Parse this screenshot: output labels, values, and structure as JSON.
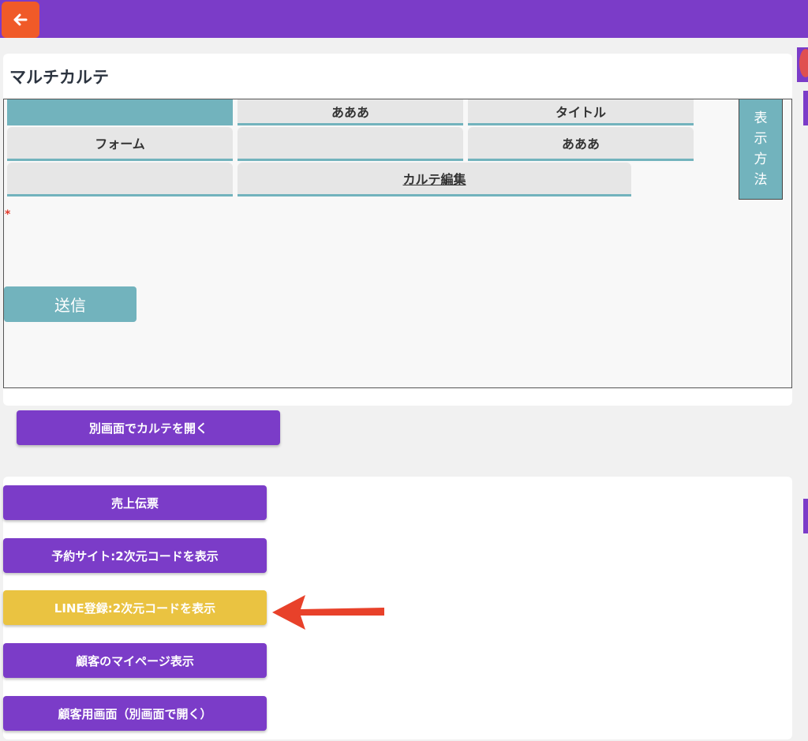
{
  "topbar": {
    "back_icon_glyph": "🡐",
    "bg_color": "#7b3cc8",
    "back_color": "#f05a28"
  },
  "karte": {
    "title": "マルチカルテ",
    "tabs_row1": [
      "",
      "あああ",
      "タイトル"
    ],
    "tabs_row2": [
      "フォーム",
      "",
      "あああ"
    ],
    "tabs_row3": [
      "",
      "カルテ編集"
    ],
    "display_toggle": [
      "表",
      "示",
      "方",
      "法"
    ],
    "required_mark": "*",
    "submit_label": "送信"
  },
  "open_separate_label": "別画面でカルテを開く",
  "actions": [
    {
      "label": "売上伝票"
    },
    {
      "label": "予約サイト:2次元コードを表示"
    },
    {
      "label": "LINE登録:2次元コードを表示"
    },
    {
      "label": "顧客のマイページ表示"
    },
    {
      "label": "顧客用画面（別画面で開く）"
    }
  ],
  "colors": {
    "accent": "#7b3cc8",
    "teal": "#72b3bd",
    "highlight": "#eac341",
    "arrow": "#e8412a"
  }
}
